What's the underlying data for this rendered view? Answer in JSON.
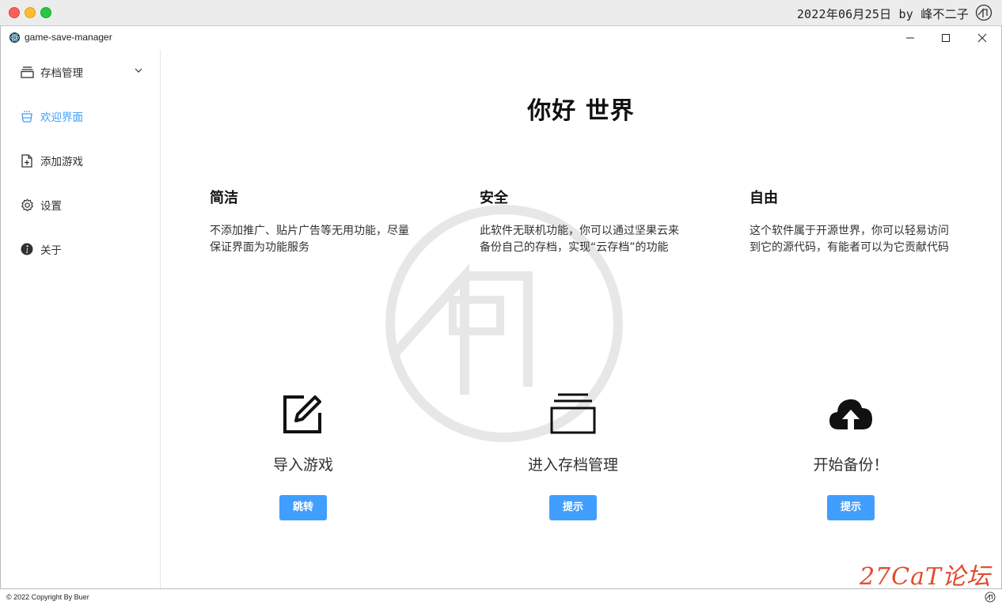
{
  "mac_bar": {
    "date_text": "2022年06月25日 by 峰不二子"
  },
  "window": {
    "title": "game-save-manager"
  },
  "sidebar": {
    "items": [
      {
        "label": "存档管理",
        "icon": "archive-stack-icon",
        "expandable": true
      },
      {
        "label": "欢迎界面",
        "icon": "coffee-cup-icon",
        "active": true
      },
      {
        "label": "添加游戏",
        "icon": "document-add-icon"
      },
      {
        "label": "设置",
        "icon": "gear-icon"
      },
      {
        "label": "关于",
        "icon": "info-icon"
      }
    ]
  },
  "main": {
    "heading": "你好 世界",
    "features": [
      {
        "title": "简洁",
        "desc": "不添加推广、贴片广告等无用功能，尽量保证界面为功能服务"
      },
      {
        "title": "安全",
        "desc": "此软件无联机功能，你可以通过坚果云来备份自己的存档，实现“云存档”的功能"
      },
      {
        "title": "自由",
        "desc": "这个软件属于开源世界，你可以轻易访问到它的源代码，有能者可以为它贡献代码"
      }
    ],
    "cards": [
      {
        "label": "导入游戏",
        "icon": "edit-icon",
        "button": "跳转"
      },
      {
        "label": "进入存档管理",
        "icon": "archive-stack-icon",
        "button": "提示"
      },
      {
        "label": "开始备份！",
        "icon": "cloud-upload-icon",
        "button": "提示"
      }
    ]
  },
  "footer": {
    "copyright": "© 2022 Copyright By Buer"
  },
  "corner_watermark": "27CaT论坛",
  "colors": {
    "accent": "#409eff",
    "text": "#303133",
    "watermark_red": "#e24a2d"
  }
}
